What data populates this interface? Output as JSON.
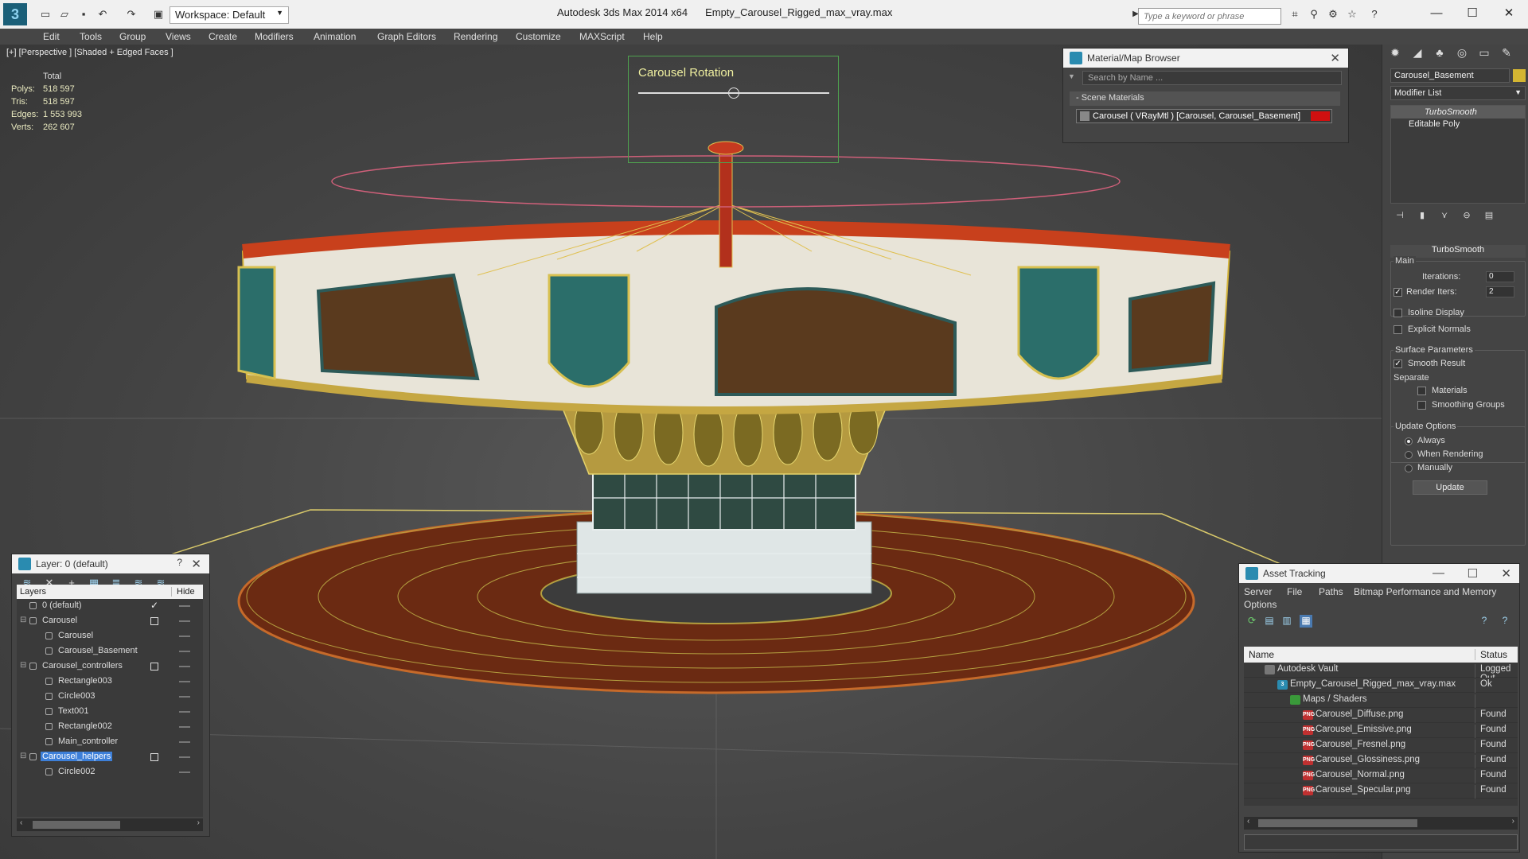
{
  "app": {
    "title": "Autodesk 3ds Max  2014 x64",
    "file": "Empty_Carousel_Rigged_max_vray.max",
    "workspace": "Workspace: Default",
    "search_placeholder": "Type a keyword or phrase"
  },
  "menu": [
    "Edit",
    "Tools",
    "Group",
    "Views",
    "Create",
    "Modifiers",
    "Animation",
    "Graph Editors",
    "Rendering",
    "Customize",
    "MAXScript",
    "Help"
  ],
  "viewport": {
    "label": "[+] [Perspective ] [Shaded + Edged Faces ]",
    "stats_header": "Total",
    "stats": [
      {
        "key": "Polys:",
        "value": "518 597"
      },
      {
        "key": "Tris:",
        "value": "518 597"
      },
      {
        "key": "Edges:",
        "value": "1 553 993"
      },
      {
        "key": "Verts:",
        "value": "262 607"
      }
    ],
    "rotation_label": "Carousel Rotation",
    "rotation_slider": 0.5
  },
  "material_browser": {
    "title": "Material/Map Browser",
    "search": "Search by Name ...",
    "section": "- Scene Materials",
    "item": "Carousel  ( VRayMtl ) [Carousel, Carousel_Basement]",
    "item_swatch": "#d01010"
  },
  "command_panel": {
    "object_name": "Carousel_Basement",
    "object_color": "#d4b632",
    "modifier_list": "Modifier List",
    "stack": [
      "TurboSmooth",
      "Editable Poly"
    ],
    "rollout": "TurboSmooth",
    "main_group": "Main",
    "iterations_label": "Iterations:",
    "iterations": "0",
    "render_iters_label": "Render Iters:",
    "render_iters": "2",
    "isoline": "Isoline Display",
    "explicit_normals": "Explicit Normals",
    "surface_group": "Surface Parameters",
    "smooth_result": "Smooth Result",
    "separate": "Separate",
    "materials": "Materials",
    "smoothing_groups": "Smoothing Groups",
    "update_group": "Update Options",
    "always": "Always",
    "when_rendering": "When Rendering",
    "manually": "Manually",
    "update_button": "Update"
  },
  "layers": {
    "title": "Layer: 0 (default)",
    "col_layers": "Layers",
    "col_hide": "Hide",
    "rows": [
      {
        "name": "0 (default)",
        "level": 0,
        "type": "layer",
        "mark": "check"
      },
      {
        "name": "Carousel",
        "level": 0,
        "type": "layer",
        "mark": "box",
        "twirl": "-"
      },
      {
        "name": "Carousel",
        "level": 1,
        "type": "object"
      },
      {
        "name": "Carousel_Basement",
        "level": 1,
        "type": "object"
      },
      {
        "name": "Carousel_controllers",
        "level": 0,
        "type": "layer",
        "mark": "box",
        "twirl": "-"
      },
      {
        "name": "Rectangle003",
        "level": 1,
        "type": "object"
      },
      {
        "name": "Circle003",
        "level": 1,
        "type": "object"
      },
      {
        "name": "Text001",
        "level": 1,
        "type": "object"
      },
      {
        "name": "Rectangle002",
        "level": 1,
        "type": "object"
      },
      {
        "name": "Main_controller",
        "level": 1,
        "type": "object"
      },
      {
        "name": "Carousel_helpers",
        "level": 0,
        "type": "layer",
        "mark": "box",
        "twirl": "-",
        "selected": true
      },
      {
        "name": "Circle002",
        "level": 1,
        "type": "object"
      }
    ]
  },
  "asset_tracking": {
    "title": "Asset Tracking",
    "menu": [
      "Server",
      "File",
      "Paths",
      "Bitmap Performance and Memory",
      "Options"
    ],
    "col_name": "Name",
    "col_status": "Status",
    "rows": [
      {
        "name": "Autodesk Vault",
        "status": "Logged Out",
        "level": 0,
        "icon": "vault"
      },
      {
        "name": "Empty_Carousel_Rigged_max_vray.max",
        "status": "Ok",
        "level": 1,
        "icon": "max"
      },
      {
        "name": "Maps / Shaders",
        "status": "",
        "level": 2,
        "icon": "maps"
      },
      {
        "name": "Carousel_Diffuse.png",
        "status": "Found",
        "level": 3,
        "icon": "png"
      },
      {
        "name": "Carousel_Emissive.png",
        "status": "Found",
        "level": 3,
        "icon": "png"
      },
      {
        "name": "Carousel_Fresnel.png",
        "status": "Found",
        "level": 3,
        "icon": "png"
      },
      {
        "name": "Carousel_Glossiness.png",
        "status": "Found",
        "level": 3,
        "icon": "png"
      },
      {
        "name": "Carousel_Normal.png",
        "status": "Found",
        "level": 3,
        "icon": "png"
      },
      {
        "name": "Carousel_Specular.png",
        "status": "Found",
        "level": 3,
        "icon": "png"
      }
    ]
  }
}
